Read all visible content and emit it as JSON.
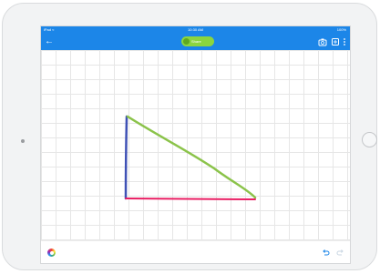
{
  "status_bar": {
    "carrier": "iPad ≈",
    "time": "10:30 AM",
    "battery": "100%"
  },
  "toolbar": {
    "share_label": "Share",
    "accent_color": "#1c86e8",
    "share_color": "#8bd53f"
  },
  "canvas": {
    "background": "grid",
    "strokes": [
      {
        "color": "#3f51b5",
        "name": "vertical-side"
      },
      {
        "color": "#8bc34a",
        "name": "hypotenuse"
      },
      {
        "color": "#e91e63",
        "name": "horizontal-side"
      }
    ]
  },
  "bottom_bar": {
    "icons": [
      "color-wheel-icon",
      "undo-icon",
      "redo-icon"
    ]
  }
}
